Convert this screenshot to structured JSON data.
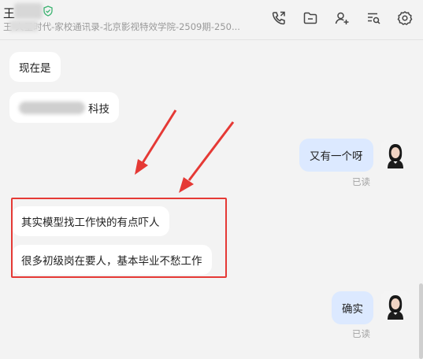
{
  "header": {
    "contact_name": "王",
    "subtitle": "王 火星时代-家校通讯录-北京影视特效学院-2509期-250...",
    "icons": [
      "call-icon",
      "folder-icon",
      "add-user-icon",
      "chat-history-icon",
      "settings-icon"
    ]
  },
  "messages": [
    {
      "side": "left",
      "text": "现在是"
    },
    {
      "side": "left",
      "text": "科技",
      "partially_blurred": true
    },
    {
      "side": "right",
      "text": "又有一个呀",
      "status": "已读"
    },
    {
      "side": "left",
      "text": "其实模型找工作快的有点吓人"
    },
    {
      "side": "left",
      "text": "很多初级岗在要人，基本毕业不愁工作"
    },
    {
      "side": "right",
      "text": "确实",
      "status": "已读"
    }
  ],
  "colors": {
    "background": "#f3f3f3",
    "my_bubble": "#dce9ff",
    "other_bubble": "#ffffff",
    "annotation_red": "#e53935",
    "verified_green": "#3cb371"
  }
}
